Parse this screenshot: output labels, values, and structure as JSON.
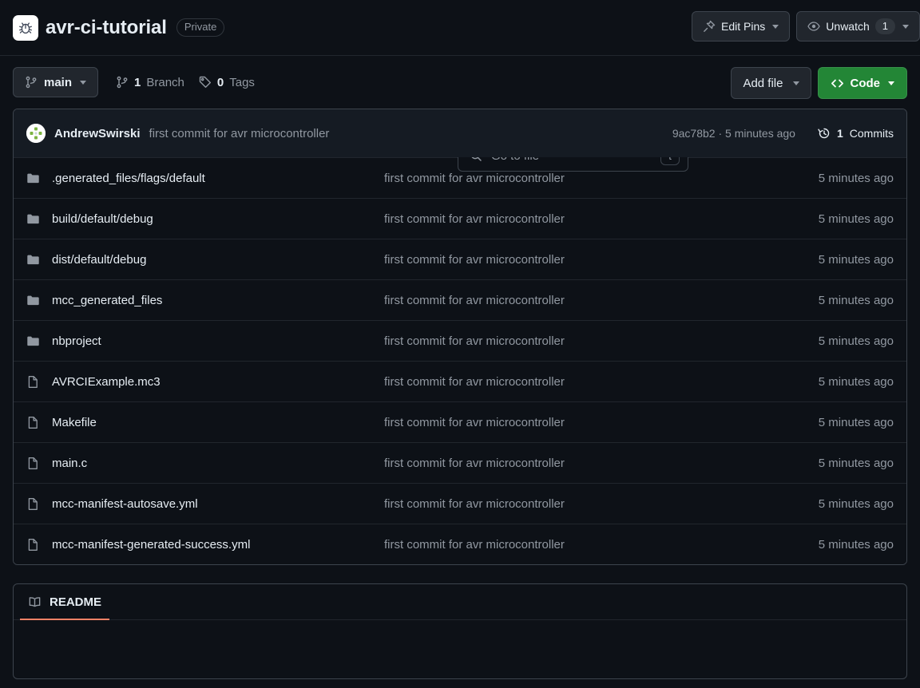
{
  "header": {
    "repo_name": "avr-ci-tutorial",
    "visibility": "Private",
    "avatar_icon": "bug-icon",
    "edit_pins_label": "Edit Pins",
    "edit_pins_icon": "pin-icon",
    "unwatch_label": "Unwatch",
    "unwatch_icon": "eye-icon",
    "watch_count": "1"
  },
  "toolbar": {
    "branch_name": "main",
    "branch_icon": "git-branch-icon",
    "branch_count": "1",
    "branch_label": "Branch",
    "tag_count": "0",
    "tag_label": "Tags",
    "tag_icon": "tag-icon",
    "search_placeholder": "Go to file",
    "search_icon": "search-icon",
    "search_shortcut": "t",
    "add_file_label": "Add file",
    "code_label": "Code",
    "code_icon": "code-brackets-icon",
    "code_button_color": "#238636"
  },
  "commit_bar": {
    "author": "AndrewSwirski",
    "message": "first commit for avr microcontroller",
    "sha_and_time": "9ac78b2 · 5 minutes ago",
    "commits_count": "1",
    "commits_label": "Commits",
    "commits_icon": "history-icon"
  },
  "files": {
    "rows": [
      {
        "name": ".generated_files/flags/default",
        "type": "folder",
        "message": "first commit for avr microcontroller",
        "age": "5 minutes ago"
      },
      {
        "name": "build/default/debug",
        "type": "folder",
        "message": "first commit for avr microcontroller",
        "age": "5 minutes ago"
      },
      {
        "name": "dist/default/debug",
        "type": "folder",
        "message": "first commit for avr microcontroller",
        "age": "5 minutes ago"
      },
      {
        "name": "mcc_generated_files",
        "type": "folder",
        "message": "first commit for avr microcontroller",
        "age": "5 minutes ago"
      },
      {
        "name": "nbproject",
        "type": "folder",
        "message": "first commit for avr microcontroller",
        "age": "5 minutes ago"
      },
      {
        "name": "AVRCIExample.mc3",
        "type": "file",
        "message": "first commit for avr microcontroller",
        "age": "5 minutes ago"
      },
      {
        "name": "Makefile",
        "type": "file",
        "message": "first commit for avr microcontroller",
        "age": "5 minutes ago"
      },
      {
        "name": "main.c",
        "type": "file",
        "message": "first commit for avr microcontroller",
        "age": "5 minutes ago"
      },
      {
        "name": "mcc-manifest-autosave.yml",
        "type": "file",
        "message": "first commit for avr microcontroller",
        "age": "5 minutes ago"
      },
      {
        "name": "mcc-manifest-generated-success.yml",
        "type": "file",
        "message": "first commit for avr microcontroller",
        "age": "5 minutes ago"
      }
    ]
  },
  "readme": {
    "tab_label": "README",
    "tab_icon": "book-icon",
    "active_underline_color": "#f78166"
  }
}
